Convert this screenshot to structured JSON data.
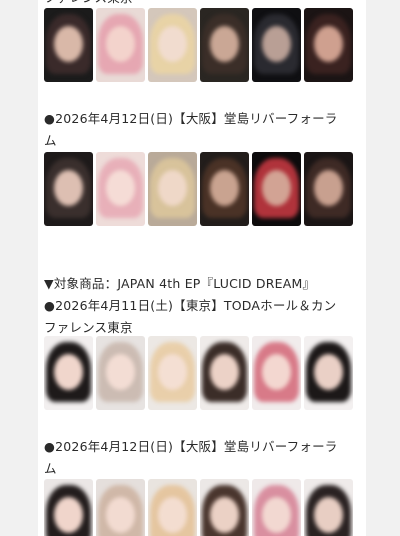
{
  "sections": [
    {
      "lines": [
        "ファレンス東京"
      ],
      "cards": [
        {
          "bg": "#1b1b1b",
          "hair": "#3a2a2a",
          "face": "#d9b8a8"
        },
        {
          "bg": "#e9dad6",
          "hair": "#e6a7b2",
          "face": "#f3d3cc"
        },
        {
          "bg": "#d4c7bb",
          "hair": "#e8d3a6",
          "face": "#f1dccf"
        },
        {
          "bg": "#2a2622",
          "hair": "#3b2e28",
          "face": "#caa795"
        },
        {
          "bg": "#0f0f12",
          "hair": "#2a2a30",
          "face": "#b99f95"
        },
        {
          "bg": "#1b1414",
          "hair": "#3a2220",
          "face": "#cfa08f"
        }
      ]
    },
    {
      "lines": [
        "●2026年4月12日(日)【大阪】堂島リバーフォーラ",
        "ム"
      ],
      "cards": [
        {
          "bg": "#1e1a1a",
          "hair": "#3a2f2d",
          "face": "#ddbfb2"
        },
        {
          "bg": "#eedcd9",
          "hair": "#e8b0b9",
          "face": "#f5dcd6"
        },
        {
          "bg": "#b9aa99",
          "hair": "#d8c39b",
          "face": "#efd8c8"
        },
        {
          "bg": "#221d1b",
          "hair": "#4a3226",
          "face": "#c9a390"
        },
        {
          "bg": "#0d0b0c",
          "hair": "#b0333b",
          "face": "#d2a394"
        },
        {
          "bg": "#1a1515",
          "hair": "#3e2a25",
          "face": "#c8a08f"
        }
      ]
    },
    {
      "lines": [
        "▼対象商品：JAPAN 4th EP『LUCID DREAM』",
        "●2026年4月11日(土)【東京】TODAホール＆カン",
        "ファレンス東京"
      ],
      "cards": [
        {
          "bg": "#f2efef",
          "hair": "#1e1a1a",
          "face": "#f0d6cc"
        },
        {
          "bg": "#e7e3e1",
          "hair": "#ccbcb3",
          "face": "#f3ddd4"
        },
        {
          "bg": "#ece8e4",
          "hair": "#e9cfaa",
          "face": "#f4dfd3"
        },
        {
          "bg": "#efebe9",
          "hair": "#3b2d28",
          "face": "#ecd2c7"
        },
        {
          "bg": "#f1ecec",
          "hair": "#d87a88",
          "face": "#f3d7d0"
        },
        {
          "bg": "#f3f0f0",
          "hair": "#1c1818",
          "face": "#ead0c6"
        }
      ]
    },
    {
      "lines": [
        "●2026年4月12日(日)【大阪】堂島リバーフォーラ",
        "ム"
      ],
      "cards": [
        {
          "bg": "#ebe7e6",
          "hair": "#231d1d",
          "face": "#f0d5cb"
        },
        {
          "bg": "#e5dfdc",
          "hair": "#d0b8a8",
          "face": "#f2dbd1"
        },
        {
          "bg": "#e9e4df",
          "hair": "#e5c6a0",
          "face": "#f3ddd0"
        },
        {
          "bg": "#ece8e6",
          "hair": "#4a362e",
          "face": "#ebd1c5"
        },
        {
          "bg": "#efe9e9",
          "hair": "#d98fa0",
          "face": "#f2d8d1"
        },
        {
          "bg": "#efebea",
          "hair": "#2a2222",
          "face": "#e8cec3"
        }
      ]
    }
  ]
}
